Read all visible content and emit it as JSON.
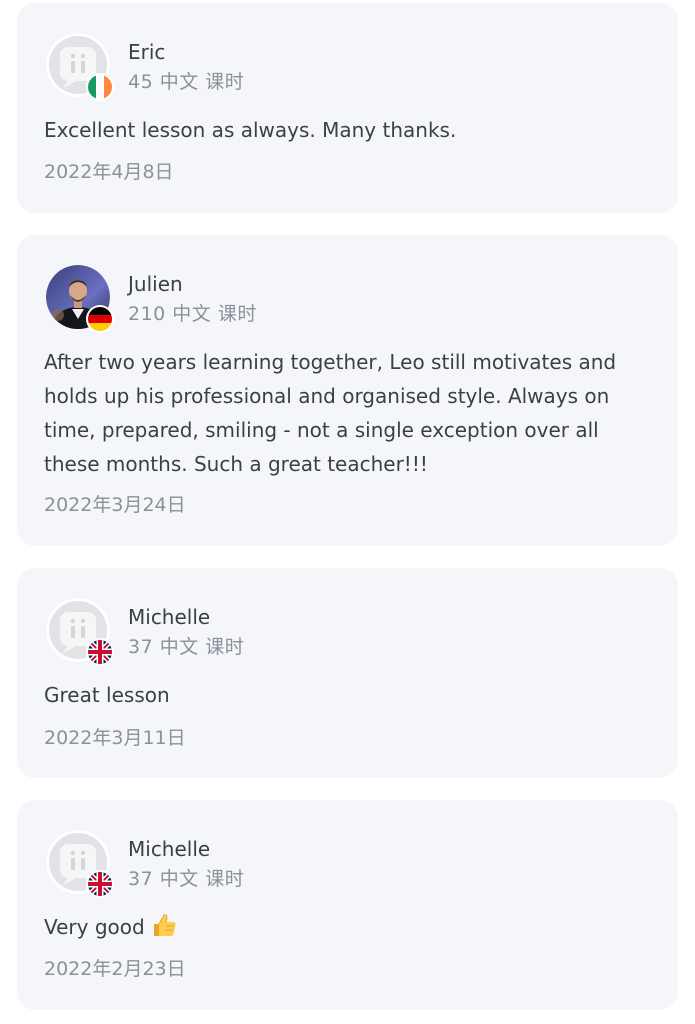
{
  "reviews": [
    {
      "name": "Eric",
      "lessons": "45 中文 课时",
      "text": "Excellent lesson as always.  Many thanks.",
      "date": "2022年4月8日",
      "flag": "ireland-flag-icon",
      "avatar": "default-avatar-icon"
    },
    {
      "name": "Julien",
      "lessons": "210 中文 课时",
      "text": "After two years learning together, Leo still motivates and holds up his professional and organised style. Always on time, prepared, smiling - not a single exception over all these months. Such a great teacher!!!",
      "date": "2022年3月24日",
      "flag": "germany-flag-icon",
      "avatar": "user-photo"
    },
    {
      "name": "Michelle",
      "lessons": "37 中文 课时",
      "text": "Great lesson",
      "date": "2022年3月11日",
      "flag": "uk-flag-icon",
      "avatar": "default-avatar-icon"
    },
    {
      "name": "Michelle",
      "lessons": "37 中文 课时",
      "text": "Very good",
      "emoji": "thumbs-up-icon",
      "date": "2022年2月23日",
      "flag": "uk-flag-icon",
      "avatar": "default-avatar-icon"
    }
  ]
}
